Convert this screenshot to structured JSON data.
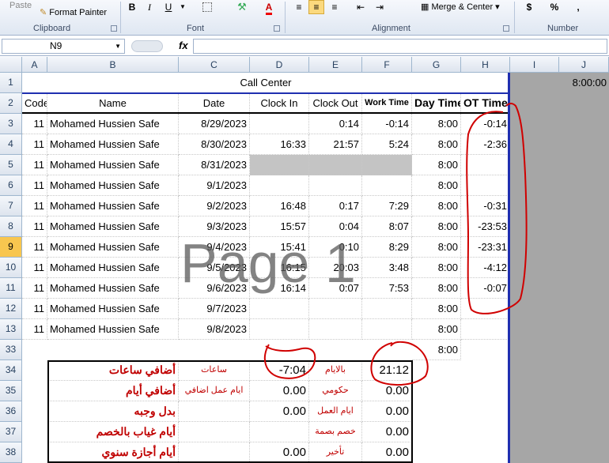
{
  "ribbon": {
    "paste": "Paste",
    "format_painter": "Format Painter",
    "clipboard": "Clipboard",
    "bold": "B",
    "italic": "I",
    "underline": "U",
    "font": "Font",
    "alignment": "Alignment",
    "merge": "Merge & Center",
    "number": "Number",
    "currency": "$",
    "percent": "%",
    "comma": ","
  },
  "formula_bar": {
    "name_box": "N9",
    "fx": "fx"
  },
  "columns": [
    "A",
    "B",
    "C",
    "D",
    "E",
    "F",
    "G",
    "H",
    "I",
    "J"
  ],
  "rows": [
    "1",
    "2",
    "3",
    "4",
    "5",
    "6",
    "7",
    "8",
    "9",
    "10",
    "11",
    "12",
    "13",
    "33",
    "34",
    "35",
    "36",
    "37",
    "38"
  ],
  "title": "Call Center",
  "j1": "8:00:00",
  "headers": {
    "code": "Code",
    "name": "Name",
    "date": "Date",
    "clock_in": "Clock In",
    "clock_out": "Clock Out",
    "work_time": "Work Time",
    "day_time": "Day Time",
    "ot_time": "OT Time"
  },
  "records": [
    {
      "code": "11",
      "name": "Mohamed Hussien Safe",
      "date": "8/29/2023",
      "in": "",
      "out": "0:14",
      "work": "-0:14",
      "day": "8:00",
      "ot": "-0:14"
    },
    {
      "code": "11",
      "name": "Mohamed Hussien Safe",
      "date": "8/30/2023",
      "in": "16:33",
      "out": "21:57",
      "work": "5:24",
      "day": "8:00",
      "ot": "-2:36"
    },
    {
      "code": "11",
      "name": "Mohamed Hussien Safe",
      "date": "8/31/2023",
      "in": "",
      "out": "",
      "work": "",
      "day": "8:00",
      "ot": ""
    },
    {
      "code": "11",
      "name": "Mohamed Hussien Safe",
      "date": "9/1/2023",
      "in": "",
      "out": "",
      "work": "",
      "day": "8:00",
      "ot": ""
    },
    {
      "code": "11",
      "name": "Mohamed Hussien Safe",
      "date": "9/2/2023",
      "in": "16:48",
      "out": "0:17",
      "work": "7:29",
      "day": "8:00",
      "ot": "-0:31"
    },
    {
      "code": "11",
      "name": "Mohamed Hussien Safe",
      "date": "9/3/2023",
      "in": "15:57",
      "out": "0:04",
      "work": "8:07",
      "day": "8:00",
      "ot": "-23:53"
    },
    {
      "code": "11",
      "name": "Mohamed Hussien Safe",
      "date": "9/4/2023",
      "in": "15:41",
      "out": "0:10",
      "work": "8:29",
      "day": "8:00",
      "ot": "-23:31"
    },
    {
      "code": "11",
      "name": "Mohamed Hussien Safe",
      "date": "9/5/2023",
      "in": "16:15",
      "out": "20:03",
      "work": "3:48",
      "day": "8:00",
      "ot": "-4:12"
    },
    {
      "code": "11",
      "name": "Mohamed Hussien Safe",
      "date": "9/6/2023",
      "in": "16:14",
      "out": "0:07",
      "work": "7:53",
      "day": "8:00",
      "ot": "-0:07"
    },
    {
      "code": "11",
      "name": "Mohamed Hussien Safe",
      "date": "9/7/2023",
      "in": "",
      "out": "",
      "work": "",
      "day": "8:00",
      "ot": ""
    },
    {
      "code": "11",
      "name": "Mohamed Hussien Safe",
      "date": "9/8/2023",
      "in": "",
      "out": "",
      "work": "",
      "day": "8:00",
      "ot": ""
    }
  ],
  "row33_day": "8:00",
  "summary": [
    {
      "label": "أضافي ساعات",
      "small": "ساعات",
      "value": "-7:04",
      "small2": "بالايام",
      "value2": "21:12"
    },
    {
      "label": "أضافي أيام",
      "small": "ايام عمل اضافي",
      "value": "0.00",
      "small2": "حكومي",
      "value2": "0.00"
    },
    {
      "label": "بدل وجبه",
      "small": "",
      "value": "0.00",
      "small2": "ايام العمل",
      "value2": "0.00"
    },
    {
      "label": "أيام غياب بالخصم",
      "small": "",
      "value": "",
      "small2": "خصم بصمة",
      "value2": "0.00"
    },
    {
      "label": "أيام أجازة سنوي",
      "small": "",
      "value": "0.00",
      "small2": "تأخير",
      "value2": "0.00"
    }
  ],
  "watermark": "Page 1",
  "colors": {
    "border_blue": "#1f2fb0",
    "annotation_red": "#d00000",
    "arabic_red": "#c00000",
    "selected_row": "#f8c64f"
  }
}
